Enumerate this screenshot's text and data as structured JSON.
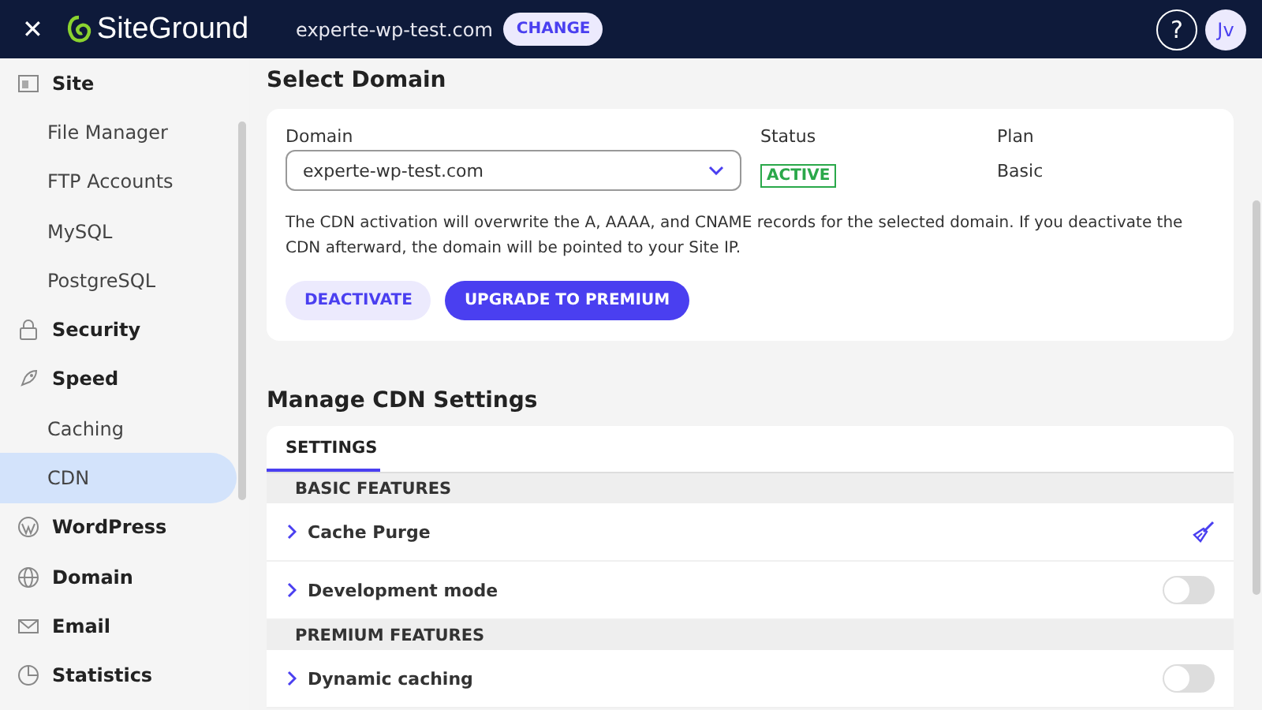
{
  "topbar": {
    "close": "✕",
    "logo": "SiteGround",
    "site": "experte-wp-test.com",
    "change_button": "CHANGE",
    "help": "?",
    "avatar": "Jv"
  },
  "sidebar": {
    "items": [
      {
        "kind": "section",
        "label": "Site",
        "selected": false
      },
      {
        "kind": "link",
        "label": "File Manager",
        "selected": false
      },
      {
        "kind": "link",
        "label": "FTP Accounts",
        "selected": false
      },
      {
        "kind": "link",
        "label": "MySQL",
        "selected": false
      },
      {
        "kind": "link",
        "label": "PostgreSQL",
        "selected": false
      },
      {
        "kind": "section",
        "label": "Security",
        "selected": false
      },
      {
        "kind": "section",
        "label": "Speed",
        "selected": false
      },
      {
        "kind": "link",
        "label": "Caching",
        "selected": false
      },
      {
        "kind": "link",
        "label": "CDN",
        "selected": true
      },
      {
        "kind": "section",
        "label": "WordPress",
        "selected": false
      },
      {
        "kind": "section",
        "label": "Domain",
        "selected": false
      },
      {
        "kind": "section",
        "label": "Email",
        "selected": false
      },
      {
        "kind": "section",
        "label": "Statistics",
        "selected": false
      }
    ]
  },
  "select_domain": {
    "title": "Select Domain",
    "domain_label": "Domain",
    "domain_value": "experte-wp-test.com",
    "status_label": "Status",
    "status": "ACTIVE",
    "plan_label": "Plan",
    "plan": "Basic",
    "note": "The CDN activation will overwrite the A, AAAA, and CNAME records for the selected domain. If you deactivate the CDN afterward, the domain will be pointed to your Site IP.",
    "buttons": [
      {
        "kind": "secondary",
        "label": "DEACTIVATE"
      },
      {
        "kind": "primary",
        "label": "UPGRADE TO PREMIUM"
      }
    ]
  },
  "cdn_settings": {
    "title": "Manage CDN Settings",
    "tabs": [
      {
        "label": "SETTINGS",
        "selected": true
      }
    ],
    "rows": [
      {
        "kind": "header",
        "label": "BASIC FEATURES"
      },
      {
        "kind": "action",
        "label": "Cache Purge"
      },
      {
        "kind": "toggle",
        "label": "Development mode",
        "on": false
      },
      {
        "kind": "header",
        "label": "PREMIUM FEATURES"
      },
      {
        "kind": "toggle",
        "label": "Dynamic caching",
        "on": false
      }
    ]
  }
}
